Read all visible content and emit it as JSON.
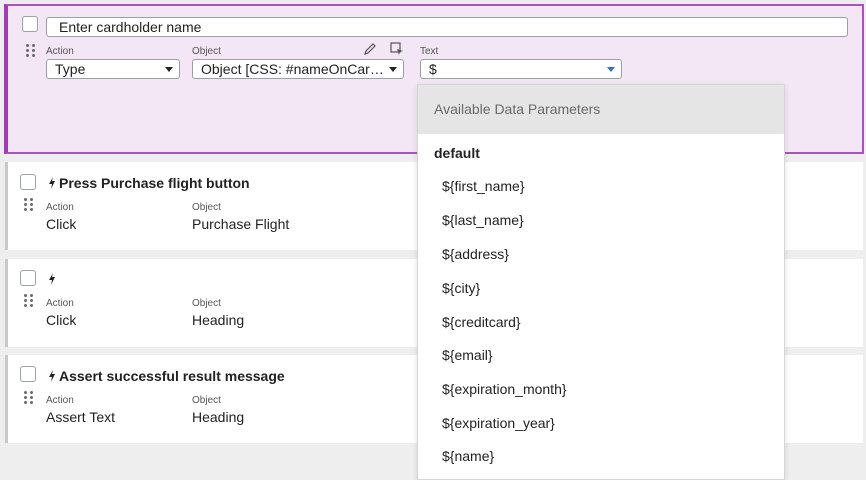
{
  "active_step": {
    "name_value": "Enter cardholder name",
    "action_label": "Action",
    "action_value": "Type",
    "object_label": "Object",
    "object_value": "Object [CSS: #nameOnCar…",
    "text_label": "Text",
    "text_value": "$"
  },
  "steps": [
    {
      "title": "Press Purchase flight button",
      "action_label": "Action",
      "action_value": "Click",
      "object_label": "Object",
      "object_value": "Purchase Flight"
    },
    {
      "title": "",
      "action_label": "Action",
      "action_value": "Click",
      "object_label": "Object",
      "object_value": "Heading"
    },
    {
      "title": "Assert successful result message",
      "action_label": "Action",
      "action_value": "Assert Text",
      "object_label": "Object",
      "object_value": "Heading"
    }
  ],
  "dropdown": {
    "header": "Available Data Parameters",
    "group": "default",
    "options": [
      "${first_name}",
      "${last_name}",
      "${address}",
      "${city}",
      "${creditcard}",
      "${email}",
      "${expiration_month}",
      "${expiration_year}",
      "${name}"
    ]
  },
  "colors": {
    "active_bg": "#f3e6f5",
    "active_border": "#a33ab8",
    "caret_accent": "#2f6fd3"
  }
}
